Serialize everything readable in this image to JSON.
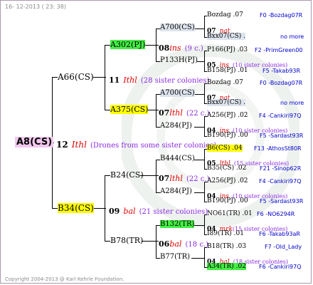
{
  "header": {
    "date": "16- 12-2013 ( 23: 38)"
  },
  "footer": {
    "copyright": "Copyright 2004-2013 @ Karl Kehrle Foundation."
  },
  "root": {
    "name": "A8(CS)",
    "year": "12",
    "queen": "Ithl",
    "note": "(Drones from some sister colonies)"
  },
  "gen1": {
    "top": {
      "name": "A66(CS)",
      "year": "11",
      "queen": "Ithl",
      "sis": "(28 sister colonies)"
    },
    "bottom": {
      "name": "B34(CS)",
      "year": "09",
      "queen": "bal",
      "sis": "(21 sister colonies)"
    }
  },
  "gen2": {
    "a302": {
      "name": "A302(PJ)",
      "year": "08",
      "queen": "ins",
      "sis": "(9 c.)"
    },
    "a375": {
      "name": "A375(CS)",
      "year": "07",
      "queen": "lthl",
      "sis": "(22 c.)"
    },
    "b24": {
      "name": "B24(CS)",
      "year": "07",
      "queen": "lthl",
      "sis": "(22 c.)"
    },
    "b78": {
      "name": "B78(TR)",
      "year": "06",
      "queen": "bal",
      "sis": "(18 c.)"
    }
  },
  "gen3": {
    "a700a": {
      "name": "A700(CS)"
    },
    "p133h": {
      "name": "P133H(PJ)"
    },
    "a700b": {
      "name": "A700(CS)"
    },
    "a284a": {
      "name": "A284(PJ)"
    },
    "b444": {
      "name": "B444(CS)"
    },
    "a284b": {
      "name": "A284(PJ)"
    },
    "b132": {
      "name": "B132(TR)"
    },
    "b77": {
      "name": "B77(TR)"
    }
  },
  "gen4": [
    {
      "name": "Bozdag .07",
      "ref": "F0 -Bozdag07R"
    },
    {
      "year": "07",
      "queen": "nat"
    },
    {
      "name": "Bxx07(CS) .",
      "ref": "no more"
    },
    {
      "name": "P166(PJ) .03",
      "ref": "F2 -PrimGreen00"
    },
    {
      "year": "05",
      "queen": "ins",
      "sis": "(10 sister colonies)"
    },
    {
      "name": "B158(PJ) .01",
      "ref": "F5 -Takab93R"
    },
    {
      "name": "Bozdag .07",
      "ref": "F0 -Bozdag07R"
    },
    {
      "year": "07",
      "queen": "nat"
    },
    {
      "name": "Bxx07(CS) .",
      "ref": "no more"
    },
    {
      "name": "A256(PJ) .02",
      "ref": "F4 -Cankiri97Q"
    },
    {
      "year": "04",
      "queen": "ins",
      "sis": "(10 sister colonies)"
    },
    {
      "name": "B190(PJ) .00",
      "ref": "F5 -Sardast93R"
    },
    {
      "name": "B6(CS) .04",
      "ref": "F13 -AthosSt80R"
    },
    {
      "year": "05",
      "queen": "lthl",
      "sis": "(15 sister colonies)"
    },
    {
      "name": "B35(CS) .02",
      "ref": "F21 -Sinop62R"
    },
    {
      "name": "A256(PJ) .02",
      "ref": "F4 -Cankiri97Q"
    },
    {
      "year": "04",
      "queen": "ins",
      "sis": "(10 sister colonies)"
    },
    {
      "name": "B190(PJ) .00",
      "ref": "F5 -Sardast93R"
    },
    {
      "name": "NO61(TR) .01",
      "ref": "F6 -NO6294R"
    },
    {
      "year": "04",
      "queen": "mrk",
      "sis": "(15 sister colonies)"
    },
    {
      "name": "I89(TR) .01",
      "ref": "F6 -Takab93aR"
    },
    {
      "name": "B18(TR) .03",
      "ref": "F7 -Old_Lady"
    },
    {
      "year": "04",
      "queen": "bal",
      "sis": "(18 sister colonies)"
    },
    {
      "name": "A34(TR) .02",
      "ref": "F6 -Cankiri97Q"
    }
  ]
}
